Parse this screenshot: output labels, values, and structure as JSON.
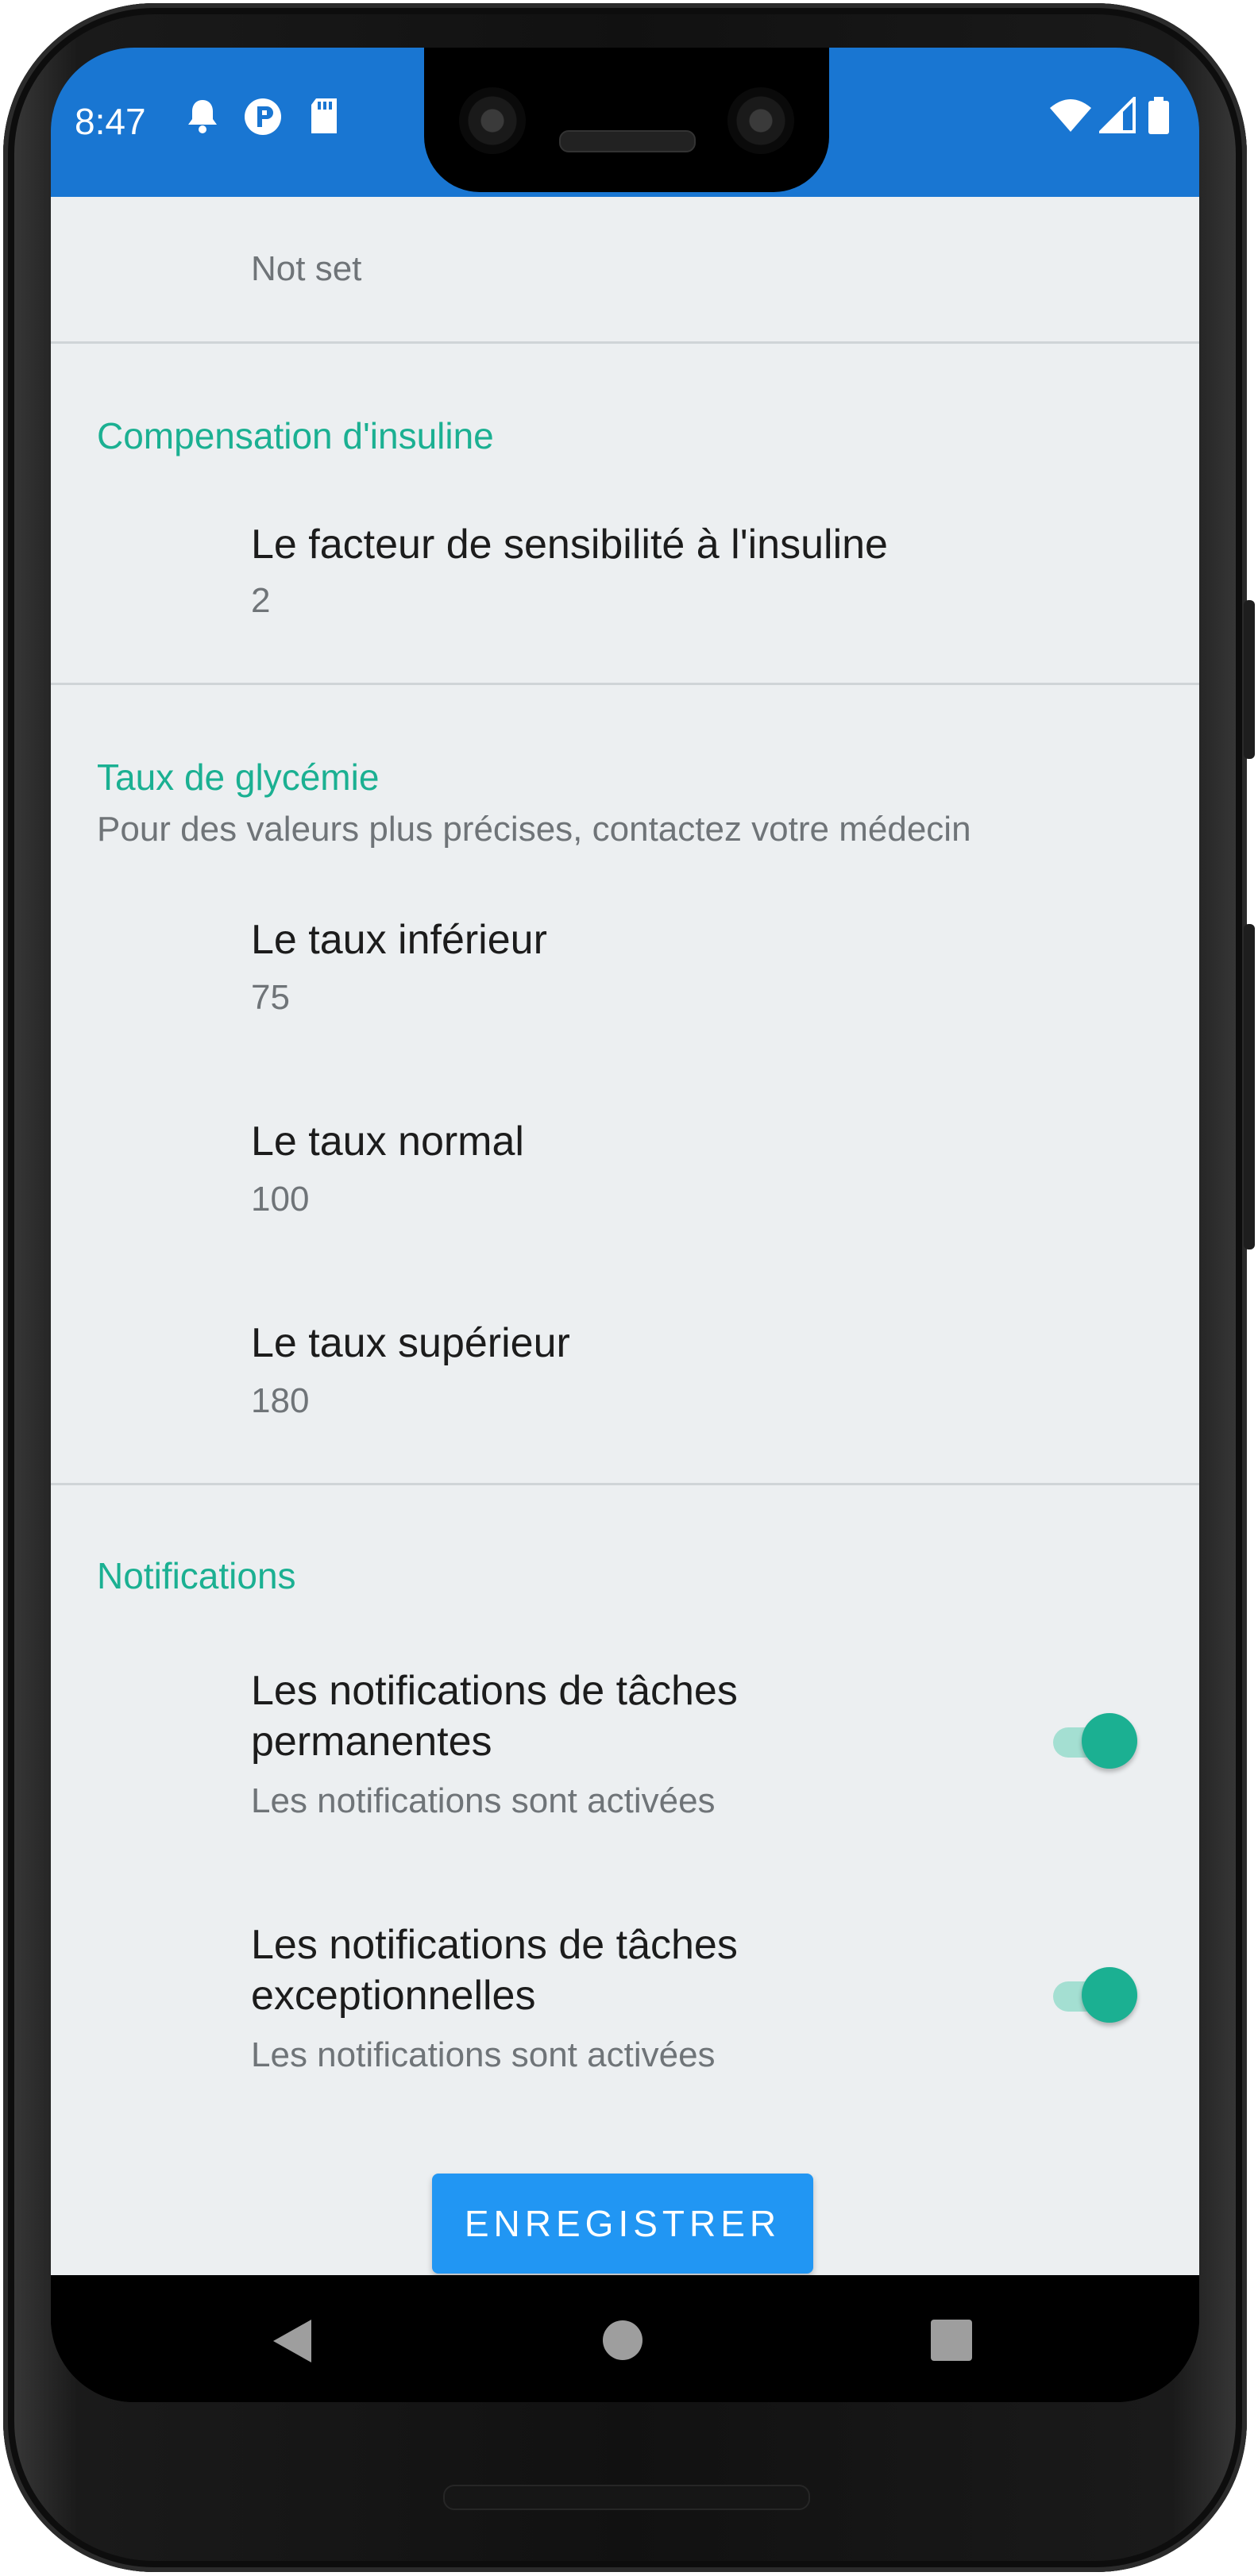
{
  "status_bar": {
    "time": "8:47",
    "background": "#1976d2",
    "left_icons": [
      "bell-icon",
      "app-icon",
      "sd-card-icon"
    ],
    "right_icons": [
      "wifi-icon",
      "signal-icon",
      "battery-icon"
    ]
  },
  "settings": {
    "top_partial": {
      "summary": "Not set"
    },
    "insulin": {
      "category": "Compensation d'insuline",
      "sensitivity": {
        "title": "Le facteur de sensibilité à l'insuline",
        "value": "2"
      }
    },
    "glucose": {
      "category": "Taux de glycémie",
      "summary": "Pour des valeurs plus précises, contactez votre médecin",
      "lower": {
        "title": "Le taux inférieur",
        "value": "75"
      },
      "normal": {
        "title": "Le taux normal",
        "value": "100"
      },
      "upper": {
        "title": "Le taux supérieur",
        "value": "180"
      }
    },
    "notifications": {
      "category": "Notifications",
      "permanent": {
        "title_line1": "Les notifications de tâches",
        "title_line2": "permanentes",
        "summary": "Les notifications sont activées",
        "enabled": true
      },
      "exceptional": {
        "title_line1": "Les notifications de tâches",
        "title_line2": "exceptionnelles",
        "summary": "Les notifications sont activées",
        "enabled": true
      }
    }
  },
  "save_button": {
    "label": "ENREGISTRER"
  },
  "nav_bar": {
    "icons": [
      "back-icon",
      "home-icon",
      "recents-icon"
    ]
  },
  "colors": {
    "accent": "#1bb092",
    "primary_button": "#2196f3",
    "background": "#eceff1"
  }
}
